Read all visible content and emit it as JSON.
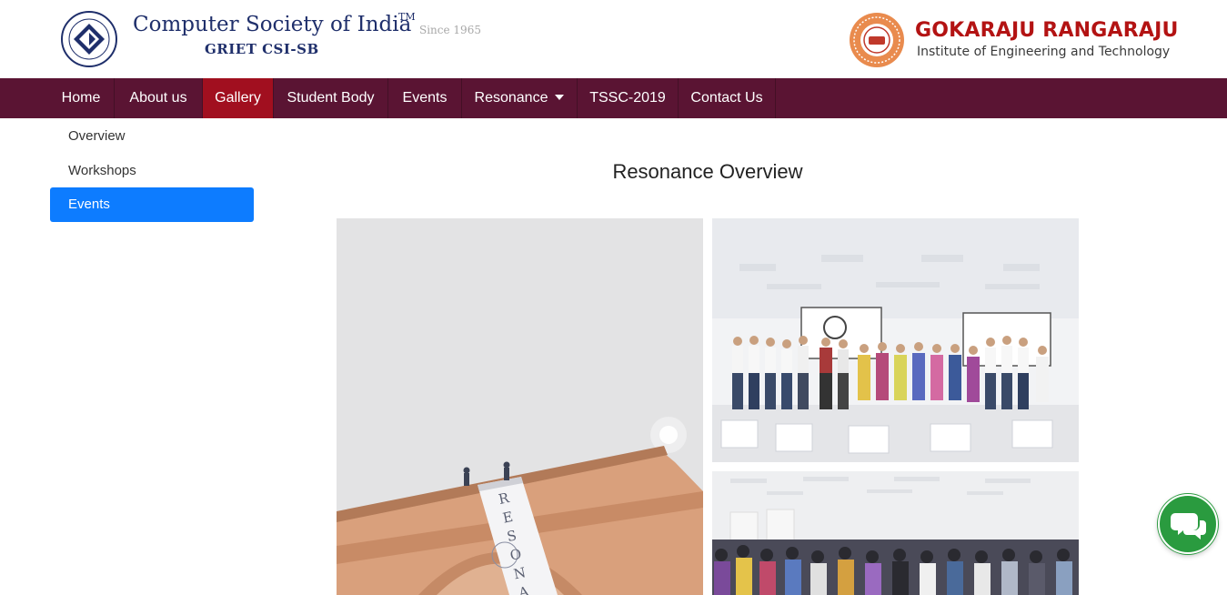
{
  "header": {
    "csi_title": "Computer Society of India",
    "csi_tm": "TM",
    "csi_since": "Since 1965",
    "csi_subtitle": "GRIET CSI-SB",
    "college_name": "GOKARAJU RANGARAJU",
    "college_subtitle": "Institute of Engineering and Technology",
    "csi_logo_icon": "csi-emblem-icon",
    "college_logo_icon": "griet-seal-icon"
  },
  "nav": {
    "items": [
      {
        "label": "Home",
        "active": false
      },
      {
        "label": "About us",
        "active": false
      },
      {
        "label": "Gallery",
        "active": true
      },
      {
        "label": "Student Body",
        "active": false
      },
      {
        "label": "Events",
        "active": false
      },
      {
        "label": "Resonance",
        "active": false,
        "dropdown": true
      },
      {
        "label": "TSSC-2019",
        "active": false
      },
      {
        "label": "Contact Us",
        "active": false
      }
    ]
  },
  "sidebar": {
    "items": [
      {
        "label": "Overview",
        "active": false
      },
      {
        "label": "Workshops",
        "active": false
      },
      {
        "label": "Events",
        "active": true
      }
    ]
  },
  "main": {
    "title": "Resonance Overview",
    "banner_text": "RESONAN"
  },
  "chat": {
    "icon": "chat-bubbles-icon"
  },
  "colors": {
    "nav_bg": "#5a1433",
    "nav_active": "#a10f1f",
    "sidebar_active": "#0d7cff",
    "chat_bg": "#2a9b3f",
    "college_red": "#b31313",
    "csi_blue": "#1f2f6b"
  }
}
